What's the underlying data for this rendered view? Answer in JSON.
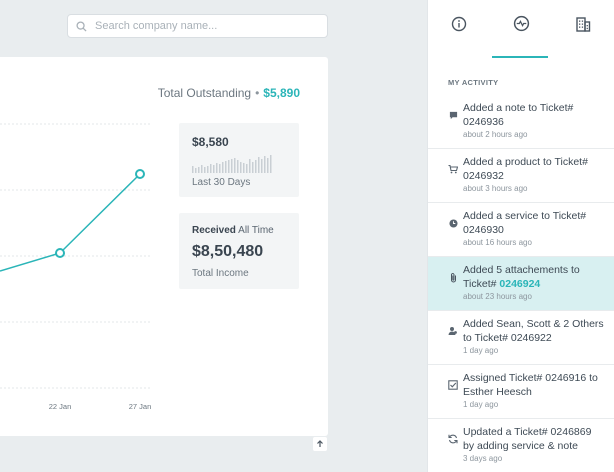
{
  "search": {
    "placeholder": "Search company name..."
  },
  "summary": {
    "label": "Total Outstanding",
    "separator": "•",
    "amount": "$5,890"
  },
  "chart_data": {
    "type": "line",
    "x": [
      "22 Jan",
      "27 Jan"
    ],
    "tick_labels": [
      "22 Jan",
      "27 Jan"
    ],
    "grid": true
  },
  "stats": {
    "last30": {
      "value": "$8,580",
      "label": "Last 30 Days"
    },
    "received": {
      "prefix": "Received",
      "suffix": "All Time",
      "value": "$8,50,480",
      "label": "Total Income"
    }
  },
  "panel": {
    "tabs": [
      {
        "icon": "info-icon"
      },
      {
        "icon": "activity-icon",
        "active": true
      },
      {
        "icon": "building-icon"
      }
    ],
    "section_title": "MY ACTIVITY",
    "activities": [
      {
        "icon": "comment-icon",
        "text": "Added a note to Ticket# 0246936",
        "time": "about 2 hours ago"
      },
      {
        "icon": "cart-icon",
        "text": "Added a product to Ticket# 0246932",
        "time": "about 3 hours ago"
      },
      {
        "icon": "clock-icon",
        "text": "Added a service to Ticket# 0246930",
        "time": "about 16 hours ago"
      },
      {
        "icon": "attachment-icon",
        "text_prefix": "Added 5 attachements to Ticket#",
        "ticket": "0246924",
        "time": "about 23 hours ago",
        "active": true
      },
      {
        "icon": "users-icon",
        "text": "Added Sean, Scott & 2 Others to Ticket# 0246922",
        "time": "1 day ago"
      },
      {
        "icon": "check-icon",
        "text": "Assigned Ticket# 0246916 to Esther Heesch",
        "time": "1 day ago"
      },
      {
        "icon": "refresh-icon",
        "text": "Updated a Ticket# 0246869 by adding service & note",
        "time": "3 days ago"
      }
    ]
  },
  "colors": {
    "accent": "#2bb5b8",
    "active_row": "#d8f0f1",
    "background": "#e9edef"
  }
}
